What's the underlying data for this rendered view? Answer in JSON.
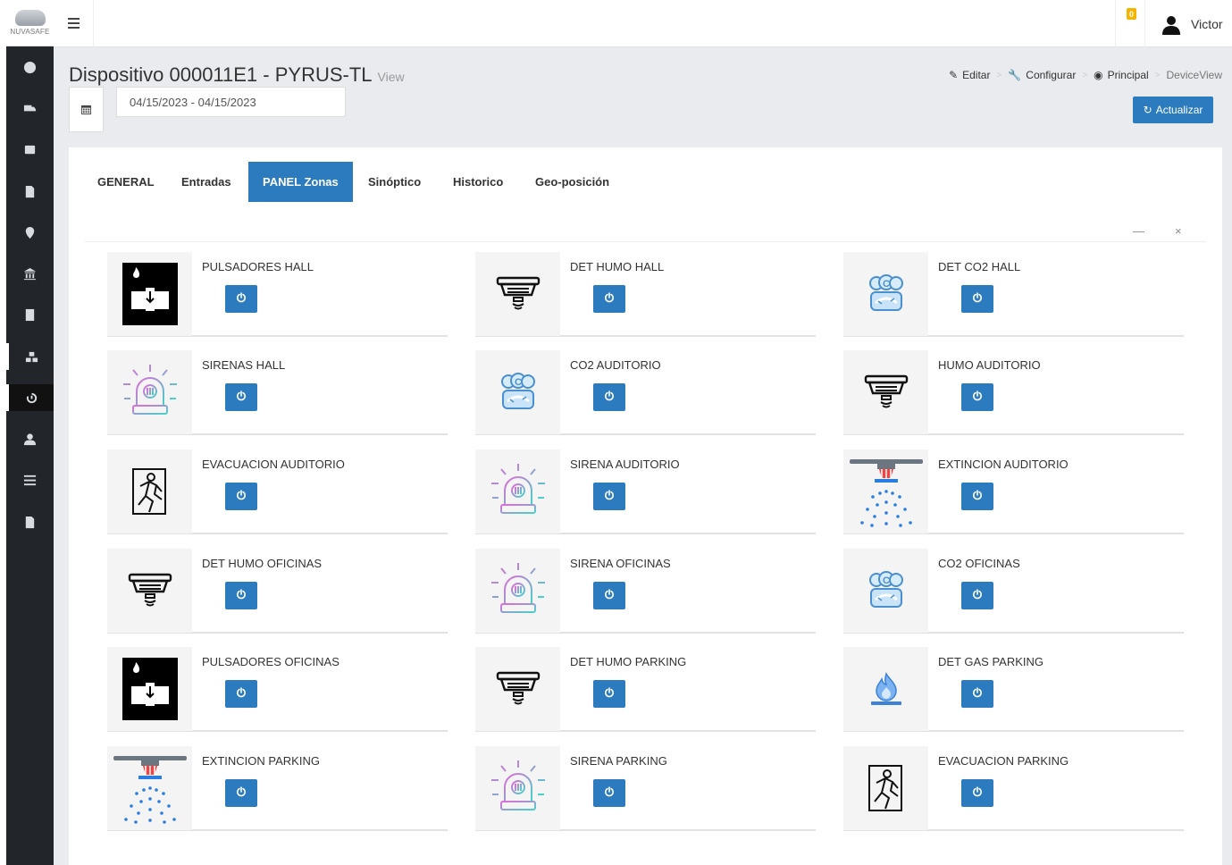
{
  "app": {
    "logo_text": "NUVASAFE",
    "user_name": "Victor",
    "notification_count": "0"
  },
  "sidebar": {
    "items": [
      {
        "icon": "dashboard-icon"
      },
      {
        "icon": "truck-icon"
      },
      {
        "icon": "table-icon"
      },
      {
        "icon": "sim-card-icon"
      },
      {
        "icon": "map-marker-icon"
      },
      {
        "icon": "institution-icon"
      },
      {
        "icon": "building-icon"
      },
      {
        "icon": "cubes-icon"
      },
      {
        "icon": "history-icon"
      },
      {
        "icon": "user-icon"
      },
      {
        "icon": "list-icon"
      },
      {
        "icon": "file-icon"
      }
    ]
  },
  "header": {
    "title": "Dispositivo 000011E1 - PYRUS-TL",
    "title_small": "View",
    "breadcrumb": [
      "Editar",
      "Configurar",
      "Principal",
      "DeviceView"
    ],
    "refresh_label": "Actualizar",
    "date_range": "04/15/2023 - 04/15/2023"
  },
  "tabs": [
    "GENERAL",
    "Entradas",
    "PANEL Zonas",
    "Sinóptico",
    "Historico",
    "Geo-posición"
  ],
  "active_tab": "PANEL Zonas",
  "panel_controls": {
    "minimize": "—",
    "close": "×"
  },
  "zones": [
    {
      "label": "PULSADORES HALL",
      "icon": "push-button-icon"
    },
    {
      "label": "DET HUMO HALL",
      "icon": "smoke-detector-icon"
    },
    {
      "label": "DET CO2 HALL",
      "icon": "co2-detector-icon"
    },
    {
      "label": "SIRENAS HALL",
      "icon": "siren-icon"
    },
    {
      "label": "CO2 AUDITORIO",
      "icon": "co2-detector-icon"
    },
    {
      "label": "HUMO AUDITORIO",
      "icon": "smoke-detector-icon"
    },
    {
      "label": "EVACUACION AUDITORIO",
      "icon": "evacuation-icon"
    },
    {
      "label": "SIRENA AUDITORIO",
      "icon": "siren-icon"
    },
    {
      "label": "EXTINCION AUDITORIO",
      "icon": "sprinkler-icon"
    },
    {
      "label": "DET HUMO OFICINAS",
      "icon": "smoke-detector-icon"
    },
    {
      "label": "SIRENA OFICINAS",
      "icon": "siren-icon"
    },
    {
      "label": "CO2 OFICINAS",
      "icon": "co2-detector-icon"
    },
    {
      "label": "PULSADORES OFICINAS",
      "icon": "push-button-icon"
    },
    {
      "label": "DET HUMO PARKING",
      "icon": "smoke-detector-icon"
    },
    {
      "label": "DET GAS PARKING",
      "icon": "gas-detector-icon"
    },
    {
      "label": "EXTINCION PARKING",
      "icon": "sprinkler-icon"
    },
    {
      "label": "SIRENA PARKING",
      "icon": "siren-icon"
    },
    {
      "label": "EVACUACION PARKING",
      "icon": "evacuation-icon"
    }
  ],
  "colors": {
    "primary": "#2c7bbf",
    "sidebar": "#22262b",
    "badge": "#f5b400"
  }
}
